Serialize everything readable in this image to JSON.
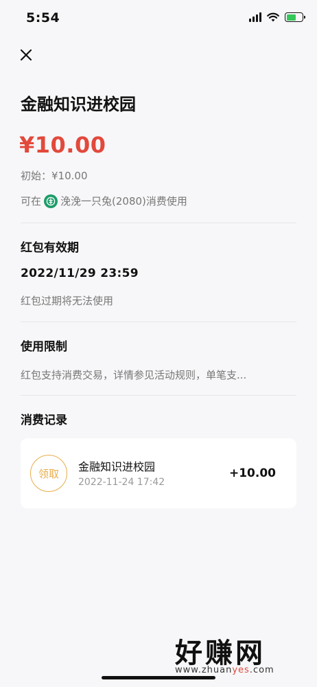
{
  "status_bar": {
    "time": "5:54"
  },
  "page": {
    "title": "金融知识进校园",
    "amount": "¥10.00",
    "initial": "初始：¥10.00",
    "usable_prefix": "可在",
    "usable_merchant": "浼浼一只兔(2080)消费使用"
  },
  "validity": {
    "heading": "红包有效期",
    "date": "2022/11/29 23:59",
    "note": "红包过期将无法使用"
  },
  "restriction": {
    "heading": "使用限制",
    "text": "红包支持消费交易，详情参见活动规则，单笔支..."
  },
  "records": {
    "heading": "消费记录",
    "items": [
      {
        "badge": "领取",
        "title": "金融知识进校园",
        "time": "2022-11-24 17:42",
        "amount": "+10.00"
      }
    ]
  },
  "watermark": {
    "logo": "好赚网",
    "url_prefix": "www.zhuan",
    "url_highlight": "yes",
    "url_suffix": ".com"
  },
  "colors": {
    "accent_red": "#e2493b",
    "badge_gold": "#e9ad4a",
    "bank_green": "#1d9c6a",
    "battery_green": "#35c759"
  },
  "icons": [
    "close-icon",
    "signal-icon",
    "wifi-icon",
    "battery-icon",
    "bank-logo-icon"
  ]
}
